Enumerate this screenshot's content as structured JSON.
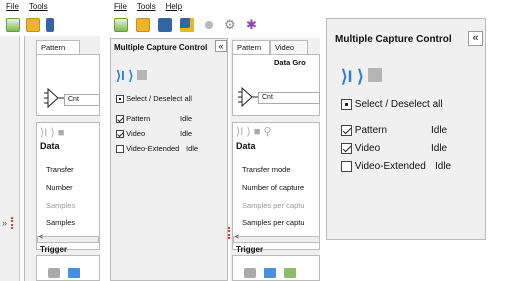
{
  "left_window": {
    "menu": [
      "File",
      "Tools"
    ],
    "tab": "Pattern",
    "cnt_label": "Cnt",
    "data_header": "Data",
    "rows": [
      "Transfer",
      "Number",
      "Samples",
      "Samples"
    ],
    "trigger": "Trigger",
    "expand_glyph": "»"
  },
  "mid_window": {
    "menu": [
      "File",
      "Tools",
      "Help"
    ],
    "panel_title": "Multiple Capture Control",
    "collapse_glyph": "«",
    "select_all": "Select / Deselect all",
    "captures": [
      {
        "name": "Pattern",
        "checked": true,
        "status": "Idle"
      },
      {
        "name": "Video",
        "checked": true,
        "status": "Idle"
      },
      {
        "name": "Video-Extended",
        "checked": false,
        "status": "Idle"
      }
    ],
    "tabs": [
      "Pattern",
      "Video"
    ],
    "data_gro": "Data Gro",
    "cnt_label": "Cnt",
    "data_header": "Data",
    "rows": [
      "Transfer mode",
      "Number of capture",
      "Samples per captu",
      "Samples per captu"
    ],
    "trigger": "Trigger"
  },
  "zoom_panel": {
    "panel_title": "Multiple Capture Control",
    "collapse_glyph": "«",
    "select_all": "Select / Deselect all",
    "captures": [
      {
        "name": "Pattern",
        "checked": true,
        "status": "Idle"
      },
      {
        "name": "Video",
        "checked": true,
        "status": "Idle"
      },
      {
        "name": "Video-Extended",
        "checked": false,
        "status": "Idle"
      }
    ]
  },
  "colors": {
    "accent": "#2d7fd8",
    "folder": "#f0b429",
    "save": "#3465a4",
    "panel_bg": "#f0f0f0"
  }
}
